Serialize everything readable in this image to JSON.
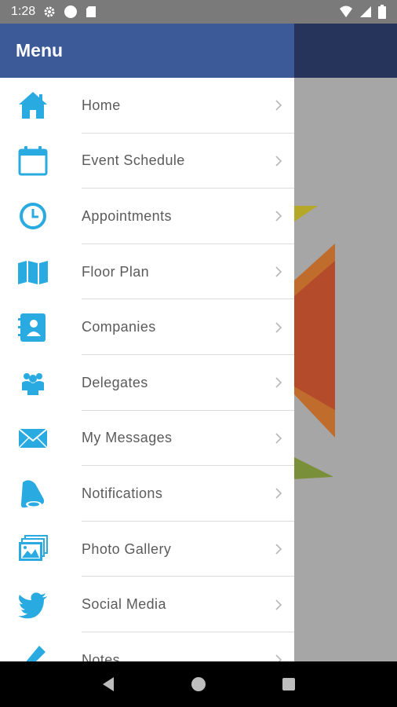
{
  "status_bar": {
    "time": "1:28",
    "left_icons": [
      "gear-icon",
      "circle-icon",
      "sd-card-icon"
    ],
    "right_icons": [
      "wifi-icon",
      "signal-icon",
      "battery-icon"
    ]
  },
  "drawer": {
    "title": "Menu",
    "accent_color": "#29abe2",
    "header_color": "#3d5a98",
    "items": [
      {
        "label": "Home",
        "icon": "home-icon"
      },
      {
        "label": "Event Schedule",
        "icon": "calendar-icon"
      },
      {
        "label": "Appointments",
        "icon": "clock-icon"
      },
      {
        "label": "Floor Plan",
        "icon": "map-icon"
      },
      {
        "label": "Companies",
        "icon": "contact-book-icon"
      },
      {
        "label": "Delegates",
        "icon": "people-icon"
      },
      {
        "label": "My Messages",
        "icon": "envelope-icon"
      },
      {
        "label": "Notifications",
        "icon": "bell-icon"
      },
      {
        "label": "Photo Gallery",
        "icon": "photos-icon"
      },
      {
        "label": "Social Media",
        "icon": "twitter-icon"
      },
      {
        "label": "Notes",
        "icon": "pencil-icon"
      }
    ]
  },
  "nav_bar": {
    "buttons": [
      "back-icon",
      "home-circle-icon",
      "recents-icon"
    ]
  }
}
